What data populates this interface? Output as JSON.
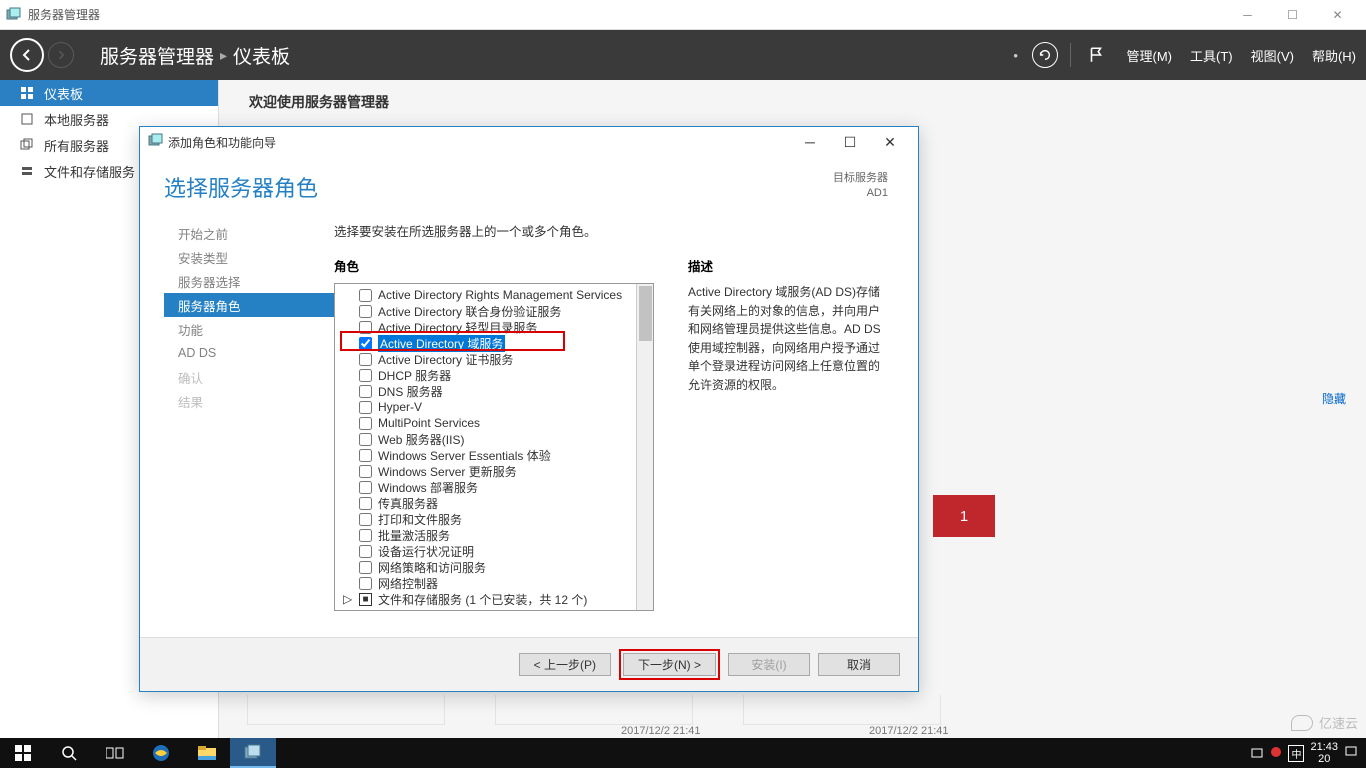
{
  "titlebar": {
    "title": "服务器管理器"
  },
  "header": {
    "breadcrumb1": "服务器管理器",
    "breadcrumb2": "仪表板",
    "menu": {
      "manage": "管理(M)",
      "tools": "工具(T)",
      "view": "视图(V)",
      "help": "帮助(H)"
    }
  },
  "leftnav": {
    "items": [
      {
        "label": "仪表板"
      },
      {
        "label": "本地服务器"
      },
      {
        "label": "所有服务器"
      },
      {
        "label": "文件和存储服务"
      }
    ]
  },
  "main": {
    "welcome": "欢迎使用服务器管理器",
    "hide": "隐藏",
    "red_tile": "1",
    "timestamp": "2017/12/2 21:41"
  },
  "wizard": {
    "title": "添加角色和功能向导",
    "heading": "选择服务器角色",
    "target_label": "目标服务器",
    "target_server": "AD1",
    "instruction": "选择要安装在所选服务器上的一个或多个角色。",
    "roles_label": "角色",
    "desc_label": "描述",
    "description": "Active Directory 域服务(AD DS)存储有关网络上的对象的信息，并向用户和网络管理员提供这些信息。AD DS 使用域控制器，向网络用户授予通过单个登录进程访问网络上任意位置的允许资源的权限。",
    "steps": [
      "开始之前",
      "安装类型",
      "服务器选择",
      "服务器角色",
      "功能",
      "AD DS",
      "确认",
      "结果"
    ],
    "active_step": 3,
    "roles": [
      {
        "label": "Active Directory Rights Management Services",
        "checked": false
      },
      {
        "label": "Active Directory 联合身份验证服务",
        "checked": false
      },
      {
        "label": "Active Directory 轻型目录服务",
        "checked": false
      },
      {
        "label": "Active Directory 域服务",
        "checked": true,
        "selected": true
      },
      {
        "label": "Active Directory 证书服务",
        "checked": false
      },
      {
        "label": "DHCP 服务器",
        "checked": false
      },
      {
        "label": "DNS 服务器",
        "checked": false
      },
      {
        "label": "Hyper-V",
        "checked": false
      },
      {
        "label": "MultiPoint Services",
        "checked": false
      },
      {
        "label": "Web 服务器(IIS)",
        "checked": false
      },
      {
        "label": "Windows Server Essentials 体验",
        "checked": false
      },
      {
        "label": "Windows Server 更新服务",
        "checked": false
      },
      {
        "label": "Windows 部署服务",
        "checked": false
      },
      {
        "label": "传真服务器",
        "checked": false
      },
      {
        "label": "打印和文件服务",
        "checked": false
      },
      {
        "label": "批量激活服务",
        "checked": false
      },
      {
        "label": "设备运行状况证明",
        "checked": false
      },
      {
        "label": "网络策略和访问服务",
        "checked": false
      },
      {
        "label": "网络控制器",
        "checked": false
      },
      {
        "label": "文件和存储服务 (1 个已安装，共 12 个)",
        "checked": "partial",
        "expandable": true
      }
    ],
    "buttons": {
      "prev": "< 上一步(P)",
      "next": "下一步(N) >",
      "install": "安装(I)",
      "cancel": "取消"
    }
  },
  "taskbar": {
    "time": "21:43",
    "date": "20"
  },
  "watermark": "亿速云"
}
